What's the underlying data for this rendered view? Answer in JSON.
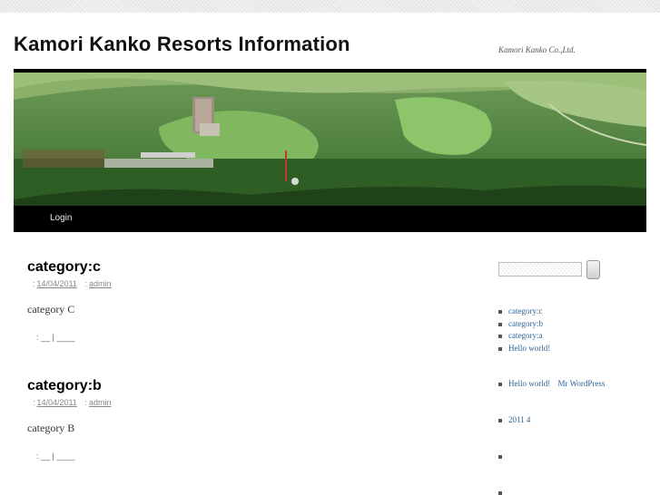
{
  "site": {
    "title": "Kamori Kanko Resorts Information",
    "description": "Kamori Kanko Co.,Ltd."
  },
  "nav": {
    "login": "Login"
  },
  "posts": [
    {
      "title": "category:c",
      "date": "14/04/2011",
      "author": "admin",
      "body": "category C",
      "footer": ":  __  |  ____"
    },
    {
      "title": "category:b",
      "date": "14/04/2011",
      "author": "admin",
      "body": "category B",
      "footer": ":  __  |  ____"
    }
  ],
  "sidebar": {
    "search": {
      "value": ""
    },
    "recent_posts": [
      "category:c",
      "category:b",
      "category:a",
      "Hello world!"
    ],
    "recent_comments": [
      {
        "post": "Hello world!",
        "author": "Mr WordPress"
      }
    ],
    "archives": [
      "2011 4"
    ]
  },
  "colors": {
    "nav_background": "#000000",
    "link": "#2a6496",
    "title": "#111111"
  }
}
